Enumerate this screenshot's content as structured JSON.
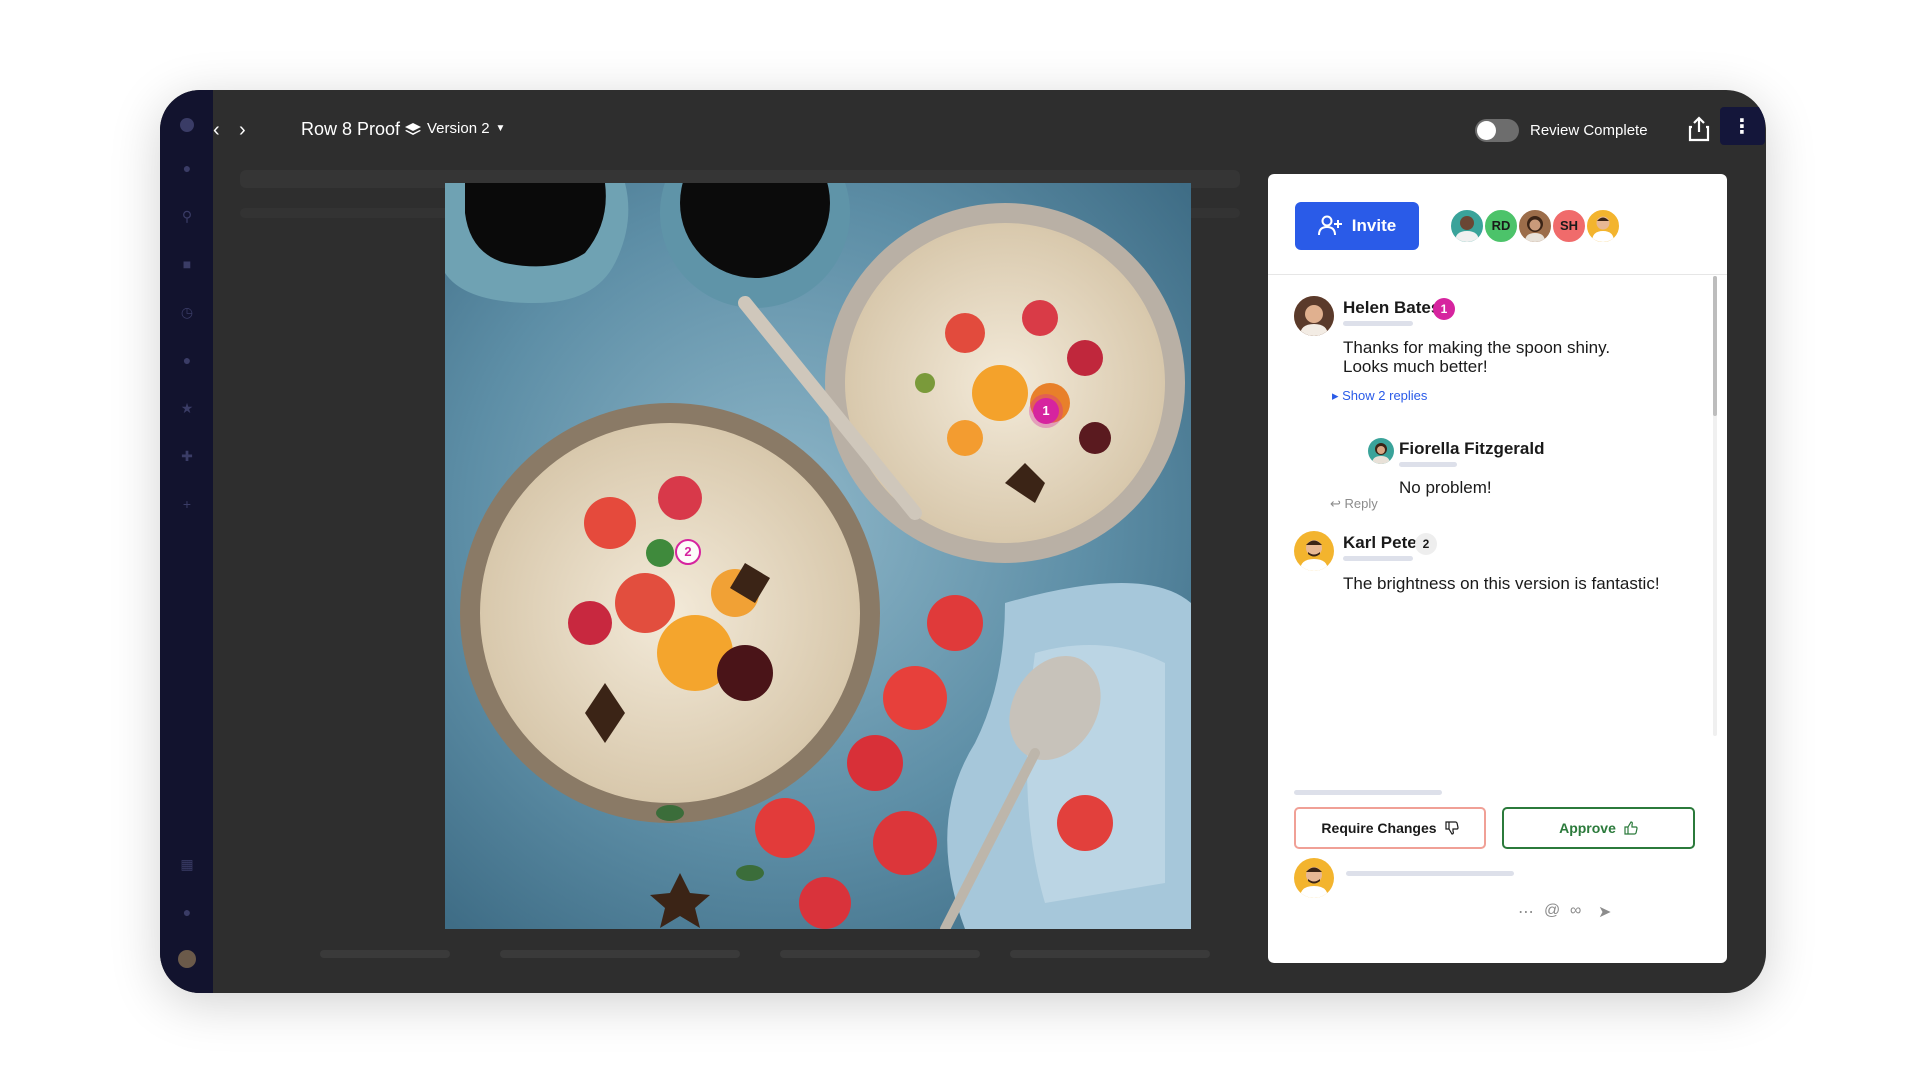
{
  "window": {
    "title": "Row 8 Proof",
    "version_label": "Version 2",
    "review_toggle_label": "Review Complete",
    "review_complete": false
  },
  "annotations": {
    "pin1": "1",
    "pin2": "2"
  },
  "panel": {
    "invite_label": "Invite",
    "avatars": [
      {
        "initials": "",
        "color": "#3aa39a"
      },
      {
        "initials": "RD",
        "color": "#4cc36a"
      },
      {
        "initials": "",
        "color": "#9c6d4a"
      },
      {
        "initials": "SH",
        "color": "#f06b6b"
      },
      {
        "initials": "",
        "color": "#f3b42e"
      }
    ],
    "comments": [
      {
        "author": "Helen Bates",
        "badge": "1",
        "text_line1": "Thanks for making the spoon shiny.",
        "text_line2": "Looks much better!",
        "show_replies": "Show 2 replies",
        "reply": {
          "author": "Fiorella Fitzgerald",
          "text": "No problem!"
        },
        "reply_label": "Reply"
      },
      {
        "author": "Karl Peter",
        "badge": "2",
        "text": "The brightness on this version is fantastic!"
      }
    ],
    "require_changes_label": "Require Changes",
    "approve_label": "Approve"
  },
  "colors": {
    "accent": "#2a5be8",
    "pin": "#d6249f",
    "approve": "#2b7a3b",
    "require": "#f0a096"
  }
}
